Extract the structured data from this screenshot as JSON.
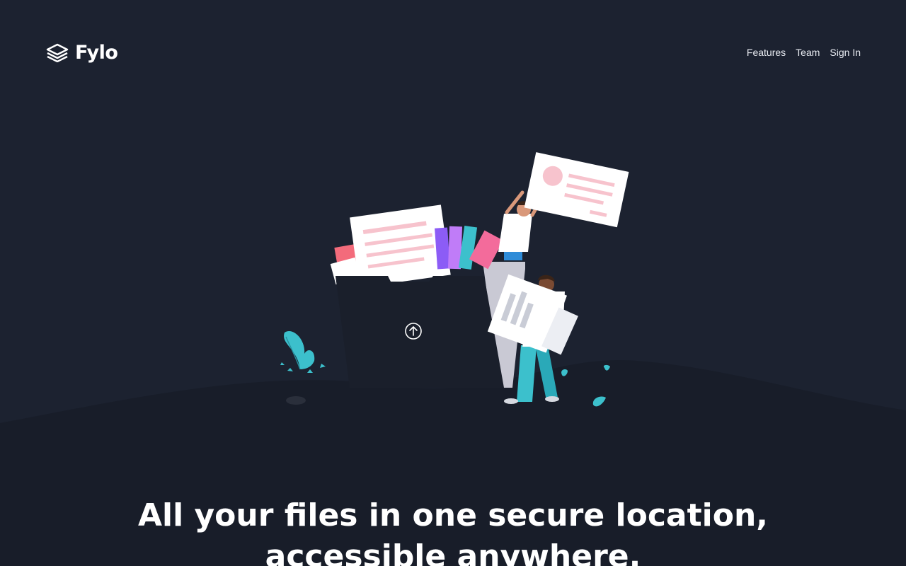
{
  "brand": {
    "name": "Fylo",
    "logo_icon": "stacked-layers-icon"
  },
  "nav": {
    "items": [
      "Features",
      "Team",
      "Sign In"
    ]
  },
  "hero": {
    "headline": "All your files in one secure location, accessible anywhere.",
    "illustration_icon": "upload-arrow-icon"
  },
  "colors": {
    "background": "#1c2230",
    "ground": "#181d29",
    "accent_teal": "#3cc0cc",
    "accent_pink": "#f3a3b2",
    "text": "#ffffff"
  }
}
